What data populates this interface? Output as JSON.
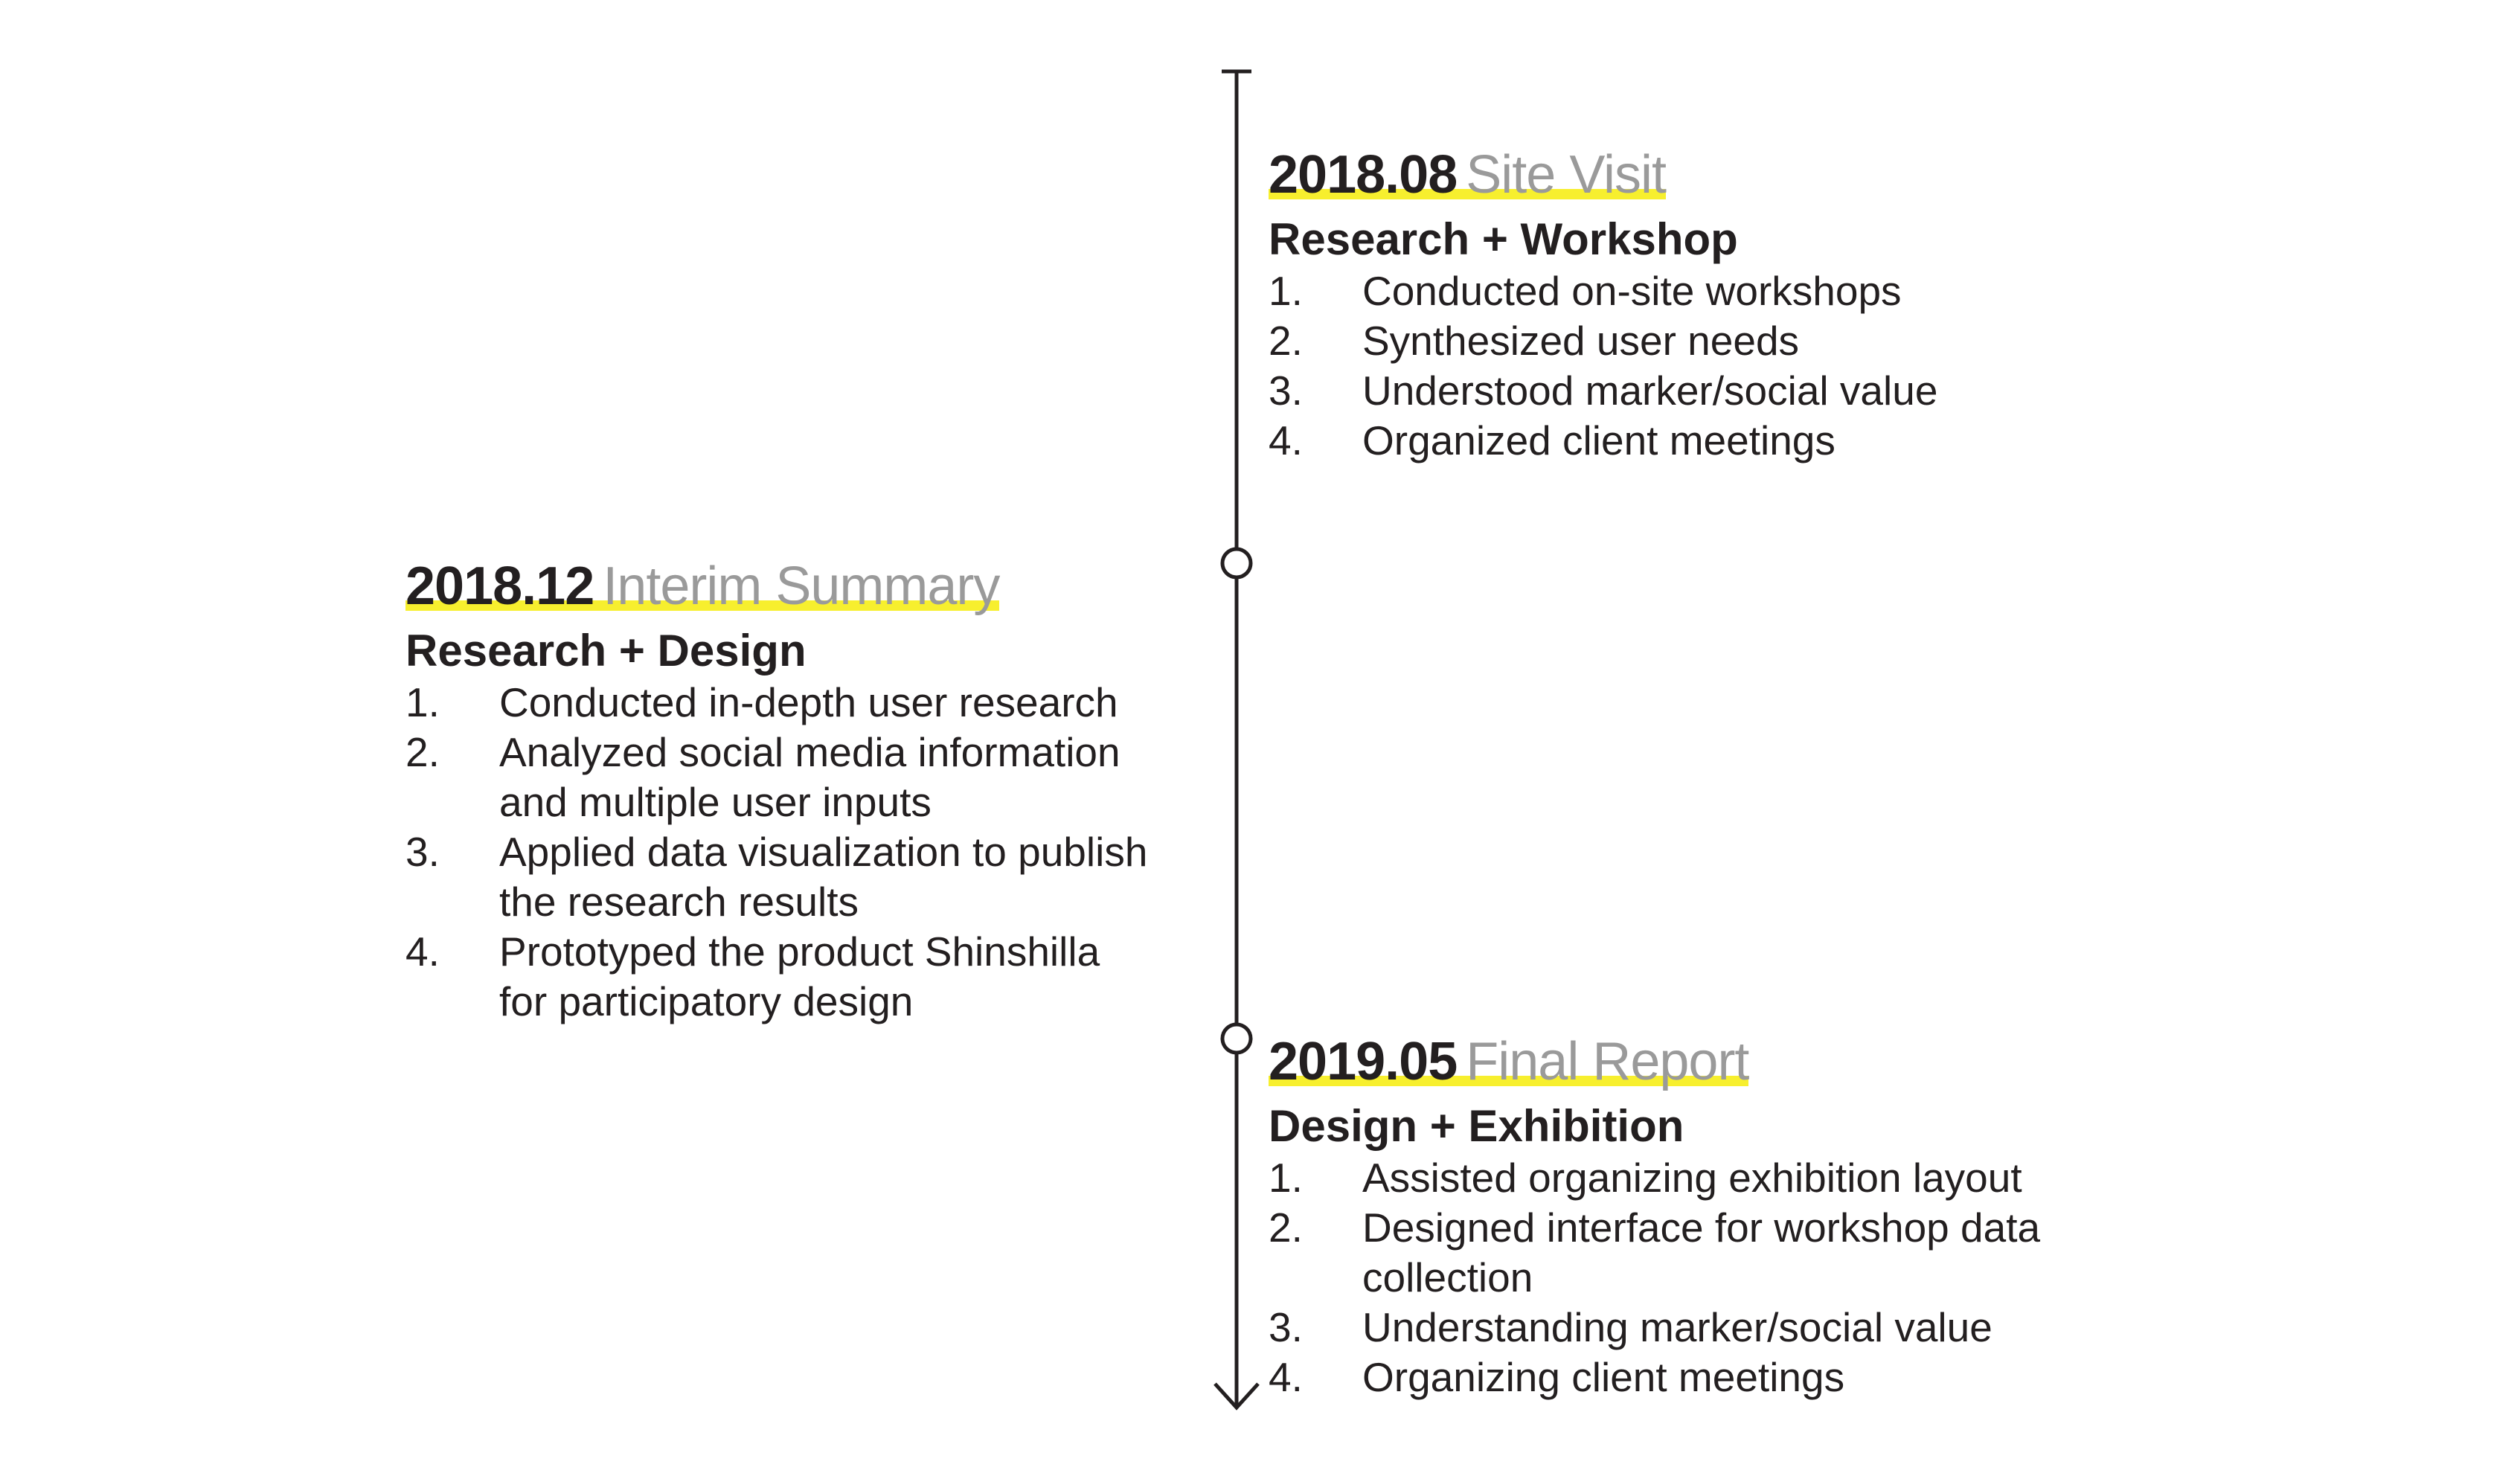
{
  "timeline": {
    "entries": [
      {
        "date": "2018.08",
        "phase": "Site Visit",
        "subtitle": "Research + Workshop",
        "items": [
          {
            "num": "1.",
            "lines": [
              "Conducted on-site workshops"
            ]
          },
          {
            "num": "2.",
            "lines": [
              "Synthesized user needs"
            ]
          },
          {
            "num": "3.",
            "lines": [
              "Understood marker/social value"
            ]
          },
          {
            "num": "4.",
            "lines": [
              "Organized client meetings"
            ]
          }
        ]
      },
      {
        "date": "2018.12",
        "phase": "Interim Summary",
        "subtitle": "Research + Design",
        "items": [
          {
            "num": "1.",
            "lines": [
              "Conducted in-depth user research"
            ]
          },
          {
            "num": "2.",
            "lines": [
              "Analyzed social media information",
              "and multiple user inputs"
            ]
          },
          {
            "num": "3.",
            "lines": [
              "Applied data visualization to publish",
              "the research results"
            ]
          },
          {
            "num": "4.",
            "lines": [
              "Prototyped the product Shinshilla",
              "for participatory design"
            ]
          }
        ]
      },
      {
        "date": "2019.05",
        "phase": "Final Report",
        "subtitle": "Design + Exhibition",
        "items": [
          {
            "num": "1.",
            "lines": [
              "Assisted organizing exhibition layout"
            ]
          },
          {
            "num": "2.",
            "lines": [
              "Designed interface for workshop data",
              "collection"
            ]
          },
          {
            "num": "3.",
            "lines": [
              "Understanding marker/social value"
            ]
          },
          {
            "num": "4.",
            "lines": [
              "Organizing client meetings"
            ]
          }
        ]
      }
    ]
  },
  "colors": {
    "text": "#231f20",
    "phase": "#9a9a9a",
    "highlight": "#f7ef2e",
    "line": "#231f20"
  },
  "icons": {
    "start": "timeline-start-tick-icon",
    "node": "timeline-node-circle-icon",
    "end": "timeline-arrow-down-icon"
  }
}
